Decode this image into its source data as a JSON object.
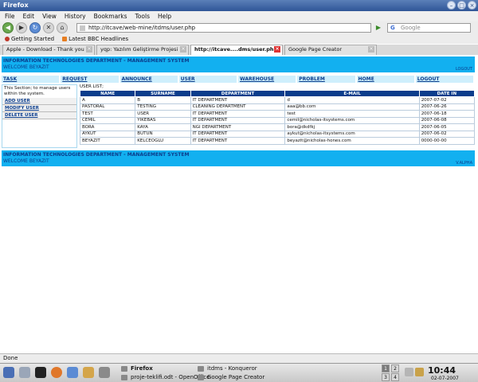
{
  "window": {
    "title": "Firefox",
    "btn_min": "–",
    "btn_max": "□",
    "btn_close": "×"
  },
  "menu": [
    "File",
    "Edit",
    "View",
    "History",
    "Bookmarks",
    "Tools",
    "Help"
  ],
  "nav": {
    "back": "◀",
    "forward": "▶",
    "reload": "↻",
    "stop": "✕",
    "home": "⌂",
    "go": "▶"
  },
  "url": "http://itcave/web-mine/itdms/user.php",
  "search_placeholder": "Google",
  "bookmarks": [
    "Getting Started",
    "Latest BBC Headlines"
  ],
  "tabs": [
    "Apple - Download - Thank you",
    "yqp: Yazılım Geliştirme Projesi",
    "http://itcave....dms/user.php",
    "Google Page Creator"
  ],
  "page": {
    "header_title": "INFORMATION TECHNOLOGIES DEPARTMENT - MANAGEMENT SYSTEM",
    "welcome": "WELCOME BEYAZIT",
    "header_right": "LOGOUT",
    "nav": [
      "TASK",
      "REQUEST",
      "ANNOUNCE",
      "USER",
      "WAREHOUSE",
      "PROBLEM",
      "HOME",
      "LOGOUT"
    ],
    "sidebar_info": "This Section; to manage users within the system.",
    "sidebar_items": [
      "ADD USER",
      "MODIFY USER",
      "DELETE USER"
    ],
    "list_caption": "USER LIST;",
    "columns": [
      "NAME",
      "SURNAME",
      "DEPARTMENT",
      "E-MAIL",
      "DATE IN"
    ],
    "rows": [
      [
        "A",
        "B",
        "IT DEPARTMENT",
        "d",
        "2007-07-02"
      ],
      [
        "PASTORAL",
        "TESTING",
        "CLEANING DEPARTMENT",
        "aaa@bb.com",
        "2007-06-26"
      ],
      [
        "TEST",
        "USER",
        "IT DEPARTMENT",
        "test",
        "2007-06-18"
      ],
      [
        "CEMIL",
        "YIKEBAS",
        "IT DEPARTMENT",
        "cemil@nicholas-itsystems.com",
        "2007-06-08"
      ],
      [
        "BORA",
        "KAYA",
        "NGI DEPARTMENT",
        "bora@dkdfkj",
        "2007-06-05"
      ],
      [
        "AYKUT",
        "BUTUN",
        "IT DEPARTMENT",
        "aykut@nicholas-itsystems.com",
        "2007-06-02"
      ],
      [
        "BEYAZIT",
        "KELCEOGLU",
        "IT DEPARTMENT",
        "beyazit@nicholas-hones.com",
        "0000-00-00"
      ]
    ],
    "footer_title": "INFORMATION TECHNOLOGIES DEPARTMENT - MANAGEMENT SYSTEM",
    "footer_welcome": "WELCOME BEYAZIT",
    "footer_right": "V.ALPHA"
  },
  "status": "Done",
  "taskbar": {
    "tasks": [
      "Firefox",
      "itdms - Konqueror",
      "proje-teklifi.odt - OpenOffice",
      "Google Page Creator"
    ],
    "desktops": [
      "1",
      "2",
      "3",
      "4"
    ],
    "time": "10:44",
    "date": "02-07-2007"
  },
  "colors": {
    "header_bg": "#12b0f0",
    "table_header": "#0b3d8c",
    "link": "#0b3d8c"
  }
}
